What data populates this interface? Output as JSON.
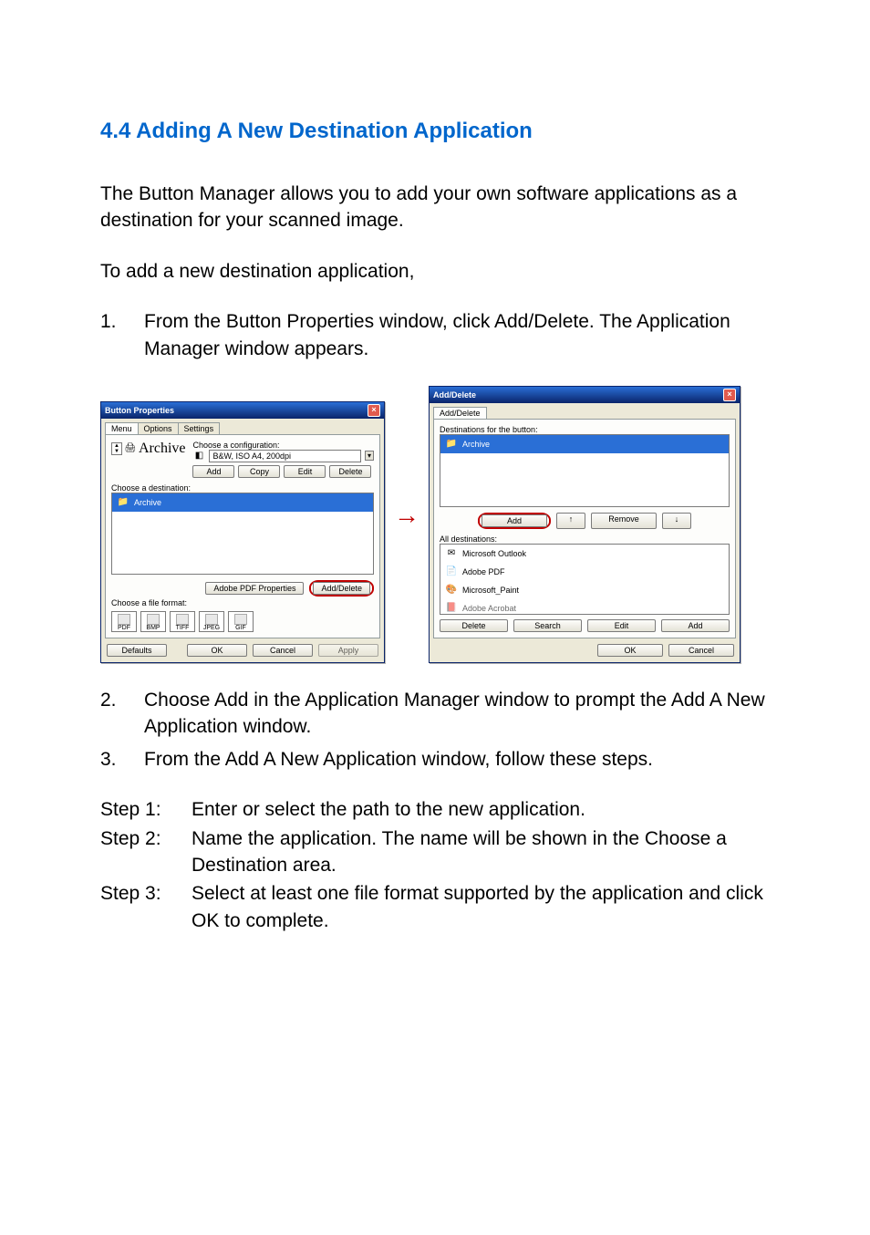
{
  "heading": "4.4    Adding A New Destination Application",
  "para1": "The Button Manager allows you to add your own software applications as a destination for your scanned image.",
  "para2": "To add a new destination application,",
  "list": [
    {
      "n": "1.",
      "t": "From the Button Properties window, click Add/Delete. The Application Manager window appears."
    },
    {
      "n": "2.",
      "t": "Choose Add in the Application Manager window to prompt the Add A New Application window."
    },
    {
      "n": "3.",
      "t": "From the Add A New Application window, follow these steps."
    }
  ],
  "steps": [
    {
      "l": "Step 1:",
      "t": "Enter or select the path to the new application."
    },
    {
      "l": "Step 2:",
      "t": "Name the application. The name will be shown in the Choose a Destination area."
    },
    {
      "l": "Step 3:",
      "t": "Select at least one file format supported by the application and click OK to complete."
    }
  ],
  "dlg1": {
    "title": "Button Properties",
    "tabs": [
      "Menu",
      "Options",
      "Settings"
    ],
    "profile": "Archive",
    "cfg_label": "Choose a configuration:",
    "cfg_value": "B&W, ISO A4, 200dpi",
    "cfg_btns": [
      "Add",
      "Copy",
      "Edit",
      "Delete"
    ],
    "dest_label": "Choose a destination:",
    "dest_sel": "Archive",
    "ff_label": "Choose a file format:",
    "pdf_btn": "Adobe PDF Properties",
    "adddel_btn": "Add/Delete",
    "formats": [
      "PDF",
      "BMP",
      "TIFF",
      "JPEG",
      "GIF"
    ],
    "footer": [
      "Defaults",
      "OK",
      "Cancel",
      "Apply"
    ]
  },
  "dlg2": {
    "title": "Add/Delete",
    "tab": "Add/Delete",
    "top_label": "Destinations for the button:",
    "top_item": "Archive",
    "mid_btns": [
      "Add",
      "↑",
      "Remove",
      "↓"
    ],
    "bot_label": "All destinations:",
    "bot_items": [
      "Microsoft Outlook",
      "Adobe PDF",
      "Microsoft_Paint",
      "Adobe Acrobat"
    ],
    "bot_btnrow": [
      "Delete",
      "Search",
      "Edit",
      "Add"
    ],
    "footer": [
      "OK",
      "Cancel"
    ]
  }
}
